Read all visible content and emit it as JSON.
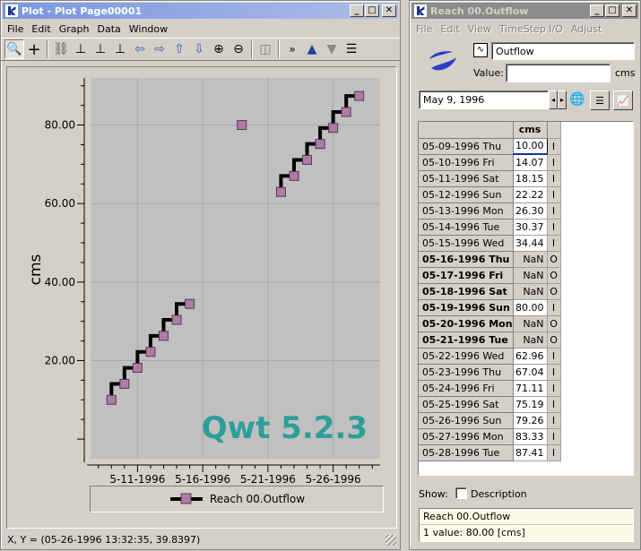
{
  "plot_window": {
    "title": "Plot - Plot Page00001",
    "menu": [
      "File",
      "Edit",
      "Graph",
      "Data",
      "Window"
    ],
    "toolbar_overflow": "»",
    "status": "X, Y = (05-26-1996 13:32:35, 39.8397)",
    "watermark": "Qwt 5.2.3",
    "legend_label": "Reach 00.Outflow"
  },
  "chart_data": {
    "type": "line",
    "ylabel": "cms",
    "xlabel": "",
    "x_ticks": [
      "5-11-1996",
      "5-16-1996",
      "5-21-1996",
      "5-26-1996"
    ],
    "y_ticks": [
      "20.00",
      "40.00",
      "60.00",
      "80.00"
    ],
    "ylim": [
      -5,
      92
    ],
    "series": [
      {
        "name": "Reach 00.Outflow",
        "x": [
          "05-09-1996",
          "05-10-1996",
          "05-11-1996",
          "05-12-1996",
          "05-13-1996",
          "05-14-1996",
          "05-15-1996",
          "05-19-1996",
          "05-22-1996",
          "05-23-1996",
          "05-24-1996",
          "05-25-1996",
          "05-26-1996",
          "05-27-1996",
          "05-28-1996"
        ],
        "values": [
          10.0,
          14.07,
          18.15,
          22.22,
          26.3,
          30.37,
          34.44,
          80.0,
          62.96,
          67.04,
          71.11,
          75.19,
          79.26,
          83.33,
          87.41
        ]
      }
    ],
    "line_color": "#000000",
    "marker_color": "#b07aa6",
    "plot_bg": "#c0c0c0",
    "grid": true,
    "legend_position": "bottom"
  },
  "data_window": {
    "title": "Reach 00.Outflow",
    "menu": [
      "File",
      "Edit",
      "View",
      "TimeStep I/O",
      "Adjust"
    ],
    "slot_name": "Outflow",
    "value_label": "Value:",
    "value_text": "",
    "unit": "cms",
    "date": "May 9, 1996",
    "column_header": "cms",
    "rows": [
      {
        "date": "05-09-1996 Thu",
        "value": "10.00",
        "flag": "I",
        "bold": false
      },
      {
        "date": "05-10-1996 Fri",
        "value": "14.07",
        "flag": "I",
        "bold": false
      },
      {
        "date": "05-11-1996 Sat",
        "value": "18.15",
        "flag": "I",
        "bold": false
      },
      {
        "date": "05-12-1996 Sun",
        "value": "22.22",
        "flag": "I",
        "bold": false
      },
      {
        "date": "05-13-1996 Mon",
        "value": "26.30",
        "flag": "I",
        "bold": false
      },
      {
        "date": "05-14-1996 Tue",
        "value": "30.37",
        "flag": "I",
        "bold": false
      },
      {
        "date": "05-15-1996 Wed",
        "value": "34.44",
        "flag": "I",
        "bold": false
      },
      {
        "date": "05-16-1996 Thu",
        "value": "NaN",
        "flag": "O",
        "bold": true
      },
      {
        "date": "05-17-1996 Fri",
        "value": "NaN",
        "flag": "O",
        "bold": true
      },
      {
        "date": "05-18-1996 Sat",
        "value": "NaN",
        "flag": "O",
        "bold": true
      },
      {
        "date": "05-19-1996 Sun",
        "value": "80.00",
        "flag": "I",
        "bold": true
      },
      {
        "date": "05-20-1996 Mon",
        "value": "NaN",
        "flag": "O",
        "bold": true
      },
      {
        "date": "05-21-1996 Tue",
        "value": "NaN",
        "flag": "O",
        "bold": true
      },
      {
        "date": "05-22-1996 Wed",
        "value": "62.96",
        "flag": "I",
        "bold": false
      },
      {
        "date": "05-23-1996 Thu",
        "value": "67.04",
        "flag": "I",
        "bold": false
      },
      {
        "date": "05-24-1996 Fri",
        "value": "71.11",
        "flag": "I",
        "bold": false
      },
      {
        "date": "05-25-1996 Sat",
        "value": "75.19",
        "flag": "I",
        "bold": false
      },
      {
        "date": "05-26-1996 Sun",
        "value": "79.26",
        "flag": "I",
        "bold": false
      },
      {
        "date": "05-27-1996 Mon",
        "value": "83.33",
        "flag": "I",
        "bold": false
      },
      {
        "date": "05-28-1996 Tue",
        "value": "87.41",
        "flag": "I",
        "bold": false
      }
    ],
    "show_label": "Show:",
    "description_label": "Description",
    "info_name": "Reach 00.Outflow",
    "info_value": "1 value:  80.00 [cms]"
  }
}
